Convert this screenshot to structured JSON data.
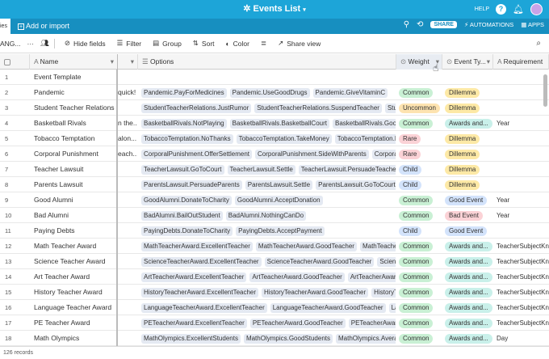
{
  "app": {
    "title": "Events List",
    "help": "HELP",
    "help_icon": "?",
    "share": "SHARE",
    "automations": "AUTOMATIONS",
    "apps": "APPS"
  },
  "tabs": {
    "active": "ies",
    "add_import": "Add or import"
  },
  "toolbar": {
    "view_name": "ANG...",
    "hide_fields": "Hide fields",
    "filter": "Filter",
    "group": "Group",
    "sort": "Sort",
    "color": "Color",
    "share_view": "Share view"
  },
  "columns": {
    "name": "Name",
    "options": "Options",
    "weight": "Weight",
    "event_type": "Event Ty...",
    "requirement": "Requirement"
  },
  "colors": {
    "Common": "#c9f0d4",
    "Uncommon": "#fde3b0",
    "Rare": "#fbd2d6",
    "Child": "#d3e3fb",
    "Dillemma": "#fde9a6",
    "Awards and...": "#c9f0ea",
    "Good Event": "#d3e3fb",
    "Bad Event": "#fbd2d6"
  },
  "rows": [
    {
      "n": "1",
      "name": "Event Template",
      "desc": "",
      "options": [],
      "weight": "",
      "type": "",
      "req": ""
    },
    {
      "n": "2",
      "name": "Pandemic",
      "desc": "quick!",
      "options": [
        "Pandemic.PayForMedicines",
        "Pandemic.UseGoodDrugs",
        "Pandemic.GiveVitaminC"
      ],
      "weight": "Common",
      "type": "Dillemma",
      "req": ""
    },
    {
      "n": "3",
      "name": "Student Teacher Relations",
      "desc": "",
      "options": [
        "StudentTeacherRelations.JustRumor",
        "StudentTeacherRelations.SuspendTeacher",
        "StudentTe"
      ],
      "weight": "Uncommon",
      "type": "Dillemma",
      "req": ""
    },
    {
      "n": "4",
      "name": "Basketball Rivals",
      "desc": "n the...",
      "options": [
        "BasketballRivals.NotPlaying",
        "BasketballRivals.BasketballCourt",
        "BasketballRivals.GoodPETea"
      ],
      "weight": "Common",
      "type": "Awards and...",
      "req": "Year"
    },
    {
      "n": "5",
      "name": "Tobacco Temptation",
      "desc": "alon...",
      "options": [
        "TobaccoTemptation.NoThanks",
        "TobaccoTemptation.TakeMoney",
        "TobaccoTemptation.Law"
      ],
      "weight": "Rare",
      "type": "Dillemma",
      "req": ""
    },
    {
      "n": "6",
      "name": "Corporal Punishment",
      "desc": "each...",
      "options": [
        "CorporalPunishment.OfferSettlement",
        "CorporalPunishment.SideWithParents",
        "CorporalPun"
      ],
      "weight": "Rare",
      "type": "Dillemma",
      "req": ""
    },
    {
      "n": "7",
      "name": "Teacher Lawsuit",
      "desc": "",
      "options": [
        "TeacherLawsuit.GoToCourt",
        "TeacherLawsuit.Settle",
        "TeacherLawsuit.PersuadeTeacher"
      ],
      "weight": "Child",
      "type": "Dillemma",
      "req": ""
    },
    {
      "n": "8",
      "name": "Parents Lawsuit",
      "desc": "",
      "options": [
        "ParentsLawsuit.PersuadeParents",
        "ParentsLawsuit.Settle",
        "ParentsLawsuit.GoToCourt"
      ],
      "weight": "Child",
      "type": "Dillemma",
      "req": ""
    },
    {
      "n": "9",
      "name": "Good Alumni",
      "desc": "",
      "options": [
        "GoodAlumni.DonateToCharity",
        "GoodAlumni.AcceptDonation"
      ],
      "weight": "Common",
      "type": "Good Event",
      "req": "Year"
    },
    {
      "n": "10",
      "name": "Bad Alumni",
      "desc": "",
      "options": [
        "BadAlumni.BailOutStudent",
        "BadAlumni.NothingCanDo"
      ],
      "weight": "Common",
      "type": "Bad Event",
      "req": "Year"
    },
    {
      "n": "11",
      "name": "Paying Debts",
      "desc": "",
      "options": [
        "PayingDebts.DonateToCharity",
        "PayingDebts.AcceptPayment"
      ],
      "weight": "Child",
      "type": "Good Event",
      "req": ""
    },
    {
      "n": "12",
      "name": "Math Teacher Award",
      "desc": "",
      "options": [
        "MathTeacherAward.ExcellentTeacher",
        "MathTeacherAward.GoodTeacher",
        "MathTeacherAwar"
      ],
      "weight": "Common",
      "type": "Awards and...",
      "req": "TeacherSubjectKn..."
    },
    {
      "n": "13",
      "name": "Science Teacher Award",
      "desc": "",
      "options": [
        "ScienceTeacherAward.ExcellentTeacher",
        "ScienceTeacherAward.GoodTeacher",
        "ScienceTeac"
      ],
      "weight": "Common",
      "type": "Awards and...",
      "req": "TeacherSubjectKn..."
    },
    {
      "n": "14",
      "name": "Art Teacher Award",
      "desc": "",
      "options": [
        "ArtTeacherAward.ExcellentTeacher",
        "ArtTeacherAward.GoodTeacher",
        "ArtTeacherAward.Aver"
      ],
      "weight": "Common",
      "type": "Awards and...",
      "req": "TeacherSubjectKn..."
    },
    {
      "n": "15",
      "name": "History Teacher Award",
      "desc": "",
      "options": [
        "HistoryTeacherAward.ExcellentTeacher",
        "HistoryTeacherAward.GoodTeacher",
        "HistoryTea"
      ],
      "weight": "Common",
      "type": "Awards and...",
      "req": "TeacherSubjectKn..."
    },
    {
      "n": "16",
      "name": "Language Teacher Award",
      "desc": "",
      "options": [
        "LanguageTeacherAward.ExcellentTeacher",
        "LanguageTeacherAward.GoodTeacher",
        "Langu"
      ],
      "weight": "Common",
      "type": "Awards and...",
      "req": "TeacherSubjectKn..."
    },
    {
      "n": "17",
      "name": "PE Teacher Award",
      "desc": "",
      "options": [
        "PETeacherAward.ExcellentTeacher",
        "PETeacherAward.GoodTeacher",
        "PETeacherAward.Avera"
      ],
      "weight": "Common",
      "type": "Awards and...",
      "req": "TeacherSubjectKn..."
    },
    {
      "n": "18",
      "name": "Math Olympics",
      "desc": "",
      "options": [
        "MathOlympics.ExcellentStudents",
        "MathOlympics.GoodStudents",
        "MathOlympics.AverageStu"
      ],
      "weight": "Common",
      "type": "Awards and...",
      "req": "Day"
    }
  ],
  "footer": {
    "records": "126 records"
  }
}
